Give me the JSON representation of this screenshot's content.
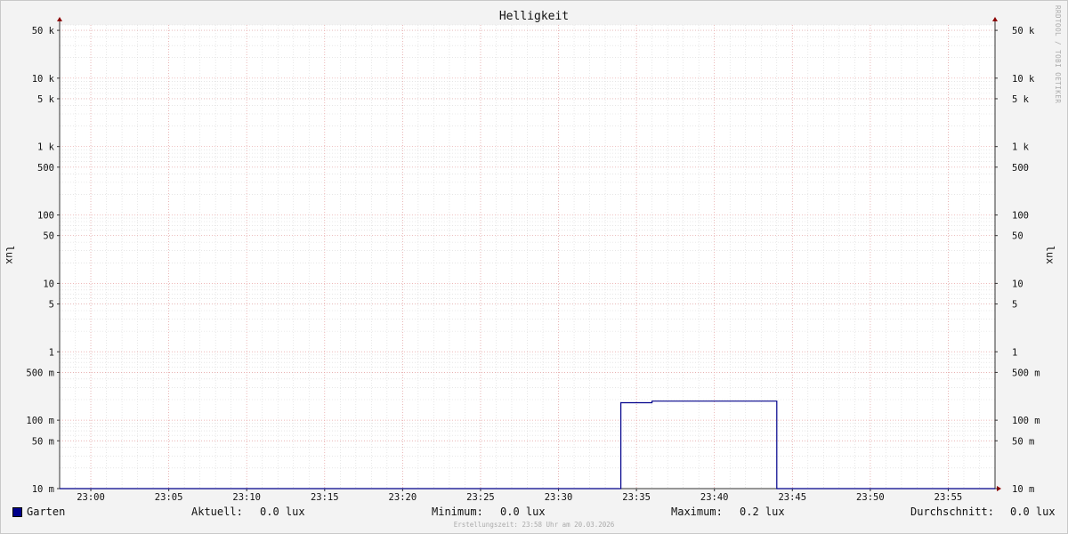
{
  "chart_data": {
    "type": "line",
    "title": "Helligkeit",
    "ylabel": "lux",
    "ylabel_right": "lux",
    "yscale": "log",
    "ylim": [
      0.01,
      60000
    ],
    "xlim": [
      "22:58",
      "23:58"
    ],
    "x_ticks": [
      "23:00",
      "23:05",
      "23:10",
      "23:15",
      "23:20",
      "23:25",
      "23:30",
      "23:35",
      "23:40",
      "23:45",
      "23:50",
      "23:55"
    ],
    "y_ticks": [
      {
        "value": 50000,
        "label": "50 k"
      },
      {
        "value": 10000,
        "label": "10 k"
      },
      {
        "value": 5000,
        "label": "5 k"
      },
      {
        "value": 1000,
        "label": "1 k"
      },
      {
        "value": 500,
        "label": "500"
      },
      {
        "value": 100,
        "label": "100"
      },
      {
        "value": 50,
        "label": "50"
      },
      {
        "value": 10,
        "label": "10"
      },
      {
        "value": 5,
        "label": "5"
      },
      {
        "value": 1,
        "label": "1"
      },
      {
        "value": 0.5,
        "label": "500 m"
      },
      {
        "value": 0.1,
        "label": "100 m"
      },
      {
        "value": 0.05,
        "label": "50 m"
      },
      {
        "value": 0.01,
        "label": "10 m"
      }
    ],
    "grid": true,
    "series": [
      {
        "name": "Garten",
        "color": "#00008b",
        "points": [
          [
            "22:58",
            0.01
          ],
          [
            "23:34",
            0.01
          ],
          [
            "23:34",
            0.18
          ],
          [
            "23:36",
            0.18
          ],
          [
            "23:36",
            0.19
          ],
          [
            "23:44",
            0.19
          ],
          [
            "23:44",
            0.01
          ],
          [
            "23:58",
            0.01
          ]
        ]
      }
    ]
  },
  "legend": {
    "series_name": "Garten",
    "current_label": "Aktuell:",
    "current_value": "0.0 lux",
    "min_label": "Minimum:",
    "min_value": "0.0 lux",
    "max_label": "Maximum:",
    "max_value": "0.2 lux",
    "avg_label": "Durchschnitt:",
    "avg_value": "0.0 lux"
  },
  "footer": "Erstellungszeit: 23:58 Uhr am 20.03.2026",
  "watermark": "RRDTOOL / TOBI OETIKER"
}
